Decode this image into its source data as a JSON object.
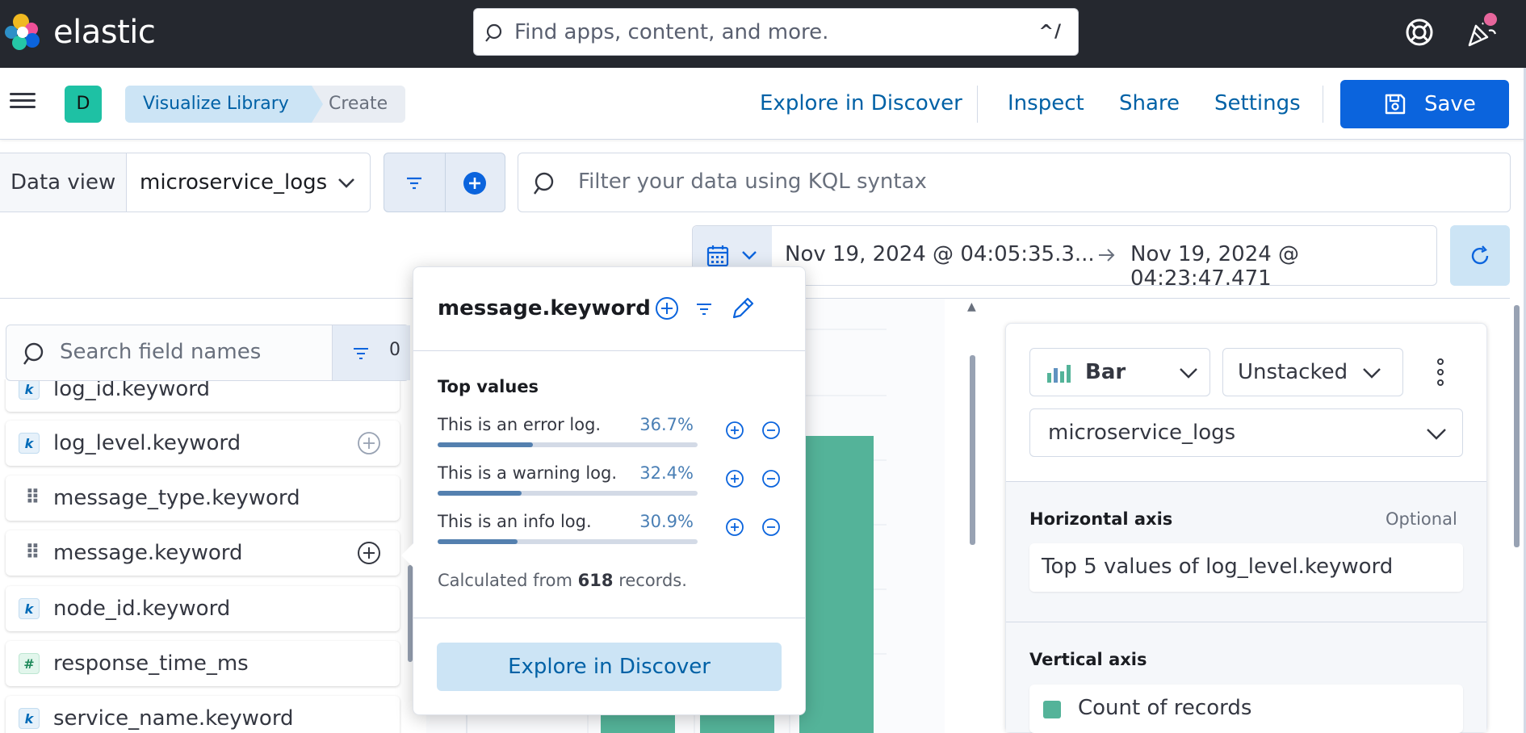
{
  "header": {
    "brand": "elastic",
    "search_placeholder": "Find apps, content, and more.",
    "search_shortcut": "^/"
  },
  "appbar": {
    "space_initial": "D",
    "breadcrumbs": [
      "Visualize Library",
      "Create"
    ],
    "links": [
      "Explore in Discover",
      "Inspect",
      "Share",
      "Settings"
    ],
    "save_label": "Save"
  },
  "query": {
    "data_view_label": "Data view",
    "data_view_value": "microservice_logs",
    "kql_placeholder": "Filter your data using KQL syntax"
  },
  "time": {
    "start": "Nov 19, 2024 @ 04:05:35.3...",
    "end": "Nov 19, 2024 @ 04:23:47.471"
  },
  "fields": {
    "search_placeholder": "Search field names",
    "filter_count": "0",
    "items": [
      {
        "name": "log_id.keyword",
        "token": "k"
      },
      {
        "name": "log_level.keyword",
        "token": "k"
      },
      {
        "name": "message_type.keyword",
        "token": "grip"
      },
      {
        "name": "message.keyword",
        "token": "grip"
      },
      {
        "name": "node_id.keyword",
        "token": "k"
      },
      {
        "name": "response_time_ms",
        "token": "#"
      },
      {
        "name": "service_name.keyword",
        "token": "k"
      }
    ]
  },
  "popover": {
    "title": "message.keyword",
    "section": "Top values",
    "values": [
      {
        "label": "This is an error log.",
        "pct": "36.7%",
        "fraction": 0.367
      },
      {
        "label": "This is a warning log.",
        "pct": "32.4%",
        "fraction": 0.324
      },
      {
        "label": "This is an info log.",
        "pct": "30.9%",
        "fraction": 0.309
      }
    ],
    "calc_prefix": "Calculated from",
    "calc_count": "618",
    "calc_suffix": "records.",
    "button": "Explore in Discover"
  },
  "config": {
    "chart_type": "Bar",
    "stacking": "Unstacked",
    "data_view": "microservice_logs",
    "horizontal_axis_label": "Horizontal axis",
    "horizontal_axis_optional": "Optional",
    "horizontal_axis_value": "Top 5 values of log_level.keyword",
    "vertical_axis_label": "Vertical axis",
    "vertical_axis_value": "Count of records"
  },
  "colors": {
    "header_bg": "#25282f",
    "primary": "#0b64dd",
    "link": "#0061a6",
    "bar": "#54b399"
  }
}
